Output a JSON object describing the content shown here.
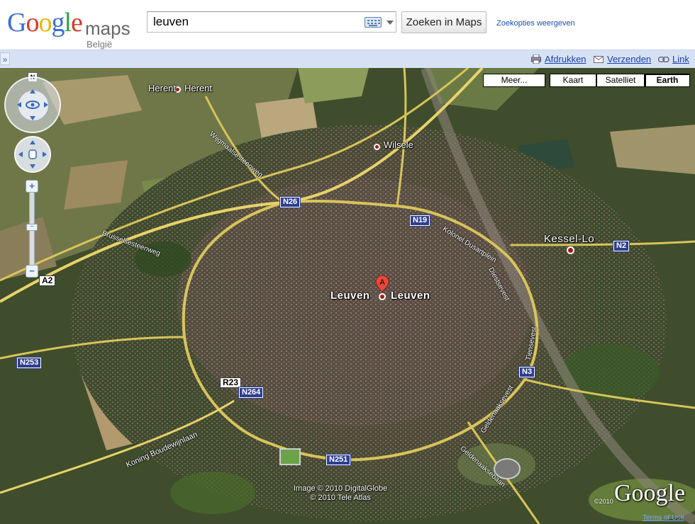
{
  "header": {
    "logo_text": "Google",
    "logo_suffix": "maps",
    "country": "België",
    "search_value": "leuven",
    "search_button": "Zoeken in Maps",
    "search_options": "Zoekopties weergeven"
  },
  "toolbar": {
    "collapse": "»",
    "print": "Afdrukken",
    "send": "Verzenden",
    "link": "Link"
  },
  "map_types": {
    "more": "Meer...",
    "map": "Kaart",
    "satellite": "Satelliet",
    "earth": "Earth",
    "selected": "Earth"
  },
  "nav": {
    "north": "N",
    "zoom_in": "+",
    "zoom_out": "−",
    "icons": [
      "look-around-icon",
      "pan-hand-icon",
      "zoom-slider"
    ]
  },
  "places": {
    "herent": "Herent",
    "herent2": "Herent",
    "wilsele": "Wilsele",
    "kessel_lo": "Kessel-Lo",
    "leuven_left": "Leuven",
    "leuven_right": "Leuven",
    "marker_letter": "A"
  },
  "roads": {
    "n26": "N26",
    "n19": "N19",
    "n2": "N2",
    "a2": "A2",
    "n253": "N253",
    "r23": "R23",
    "n264": "N264",
    "n3": "N3",
    "n251": "N251",
    "koning": "Koning Boudewijnlaan",
    "geldenaaksevest": "Geldenaaksevest",
    "geldenaaksebaan": "Geldenaaksebaan",
    "tiensevest": "Tiensevest",
    "diestsevest": "Diestsevest",
    "brusselsesteenweg": "Brusselsesteenweg",
    "vest_north": "Kolonel Dusartplein",
    "herent_road": "Wijgmaalsesteenweg"
  },
  "attribution": {
    "line1": "Image © 2010 DigitalGlobe",
    "line2": "© 2010 Tele Atlas",
    "year": "©2010",
    "google": "Google",
    "terms": "Terms of Use"
  },
  "colors": {
    "road_yellow": "#e8d26a",
    "shield_blue": "#2f3f8f",
    "link_blue": "#1c3faa",
    "toolbar_bg": "#d6e2f4"
  }
}
